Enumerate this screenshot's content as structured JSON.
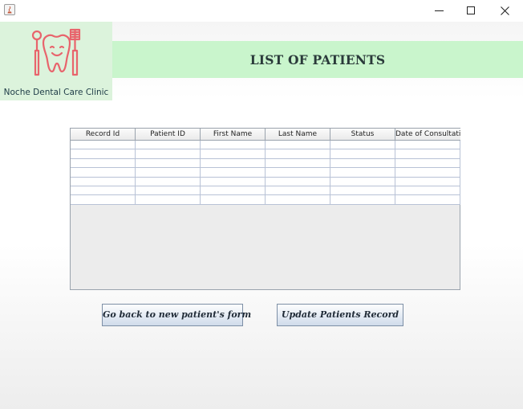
{
  "window": {
    "controls": {
      "minimize_icon": "minimize-icon",
      "maximize_icon": "maximize-icon",
      "close_icon": "close-icon"
    }
  },
  "header": {
    "clinic_name": "Noche Dental Care Clinic",
    "title": "LIST OF PATIENTS",
    "logo_icon": "tooth-logo-icon",
    "colors": {
      "logo_bg": "#dcf3dc",
      "band_bg": "#c9f5cc",
      "logo_accent": "#e8646c"
    }
  },
  "table": {
    "columns": [
      "Record Id",
      "Patient ID",
      "First Name",
      "Last Name",
      "Status",
      "Date of Consultati..."
    ],
    "rows": [
      [
        "",
        "",
        "",
        "",
        "",
        ""
      ],
      [
        "",
        "",
        "",
        "",
        "",
        ""
      ],
      [
        "",
        "",
        "",
        "",
        "",
        ""
      ],
      [
        "",
        "",
        "",
        "",
        "",
        ""
      ],
      [
        "",
        "",
        "",
        "",
        "",
        ""
      ],
      [
        "",
        "",
        "",
        "",
        "",
        ""
      ],
      [
        "",
        "",
        "",
        "",
        "",
        ""
      ]
    ]
  },
  "actions": {
    "back_label": "Go back to new patient's form",
    "update_label": "Update Patients Record"
  }
}
